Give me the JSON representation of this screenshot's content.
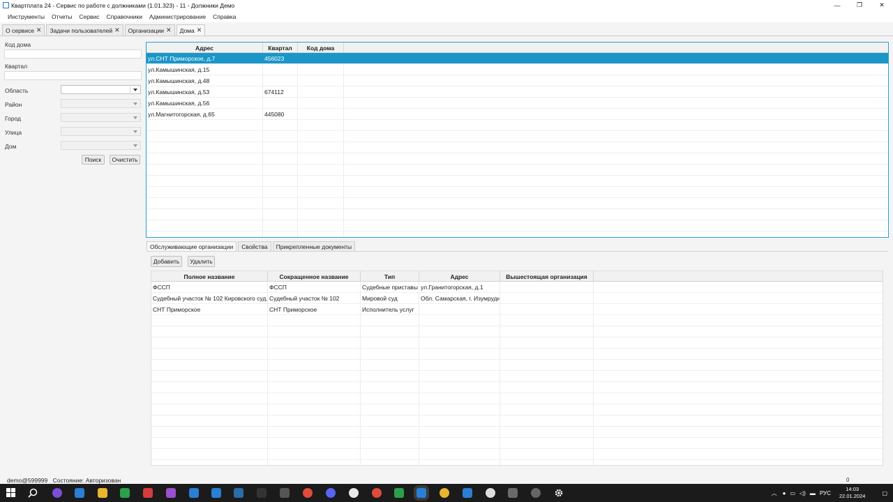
{
  "window": {
    "title": "Квартплата 24 - Сервис по работе с должниками (1.01.323) - 11 - Должники Демо",
    "controls": [
      "—",
      "❐",
      "✕"
    ]
  },
  "menu": [
    "Инструменты",
    "Отчеты",
    "Сервис",
    "Справочники",
    "Администрирование",
    "Справка"
  ],
  "doc_tabs": [
    {
      "label": "О сервисе",
      "close": "✕"
    },
    {
      "label": "Задачи пользователей",
      "close": "✕"
    },
    {
      "label": "Организации",
      "close": "✕"
    },
    {
      "label": "Дома",
      "close": "✕",
      "active": true
    }
  ],
  "filters": {
    "house_code_label": "Код дома",
    "house_code_value": "",
    "quarter_label": "Квартал",
    "quarter_value": "",
    "region_label": "Область",
    "district_label": "Район",
    "city_label": "Город",
    "street_label": "Улица",
    "house_label": "Дом",
    "search_button": "Поиск",
    "clear_button": "Очистить"
  },
  "houses": {
    "columns": [
      "Адрес",
      "Квартал",
      "Код дома"
    ],
    "rows": [
      {
        "address": "ул.СНТ Приморское, д.7",
        "quarter": "456023",
        "code": ""
      },
      {
        "address": "ул.Камышинская, д.15",
        "quarter": "",
        "code": ""
      },
      {
        "address": "ул.Камышинская, д.48",
        "quarter": "",
        "code": ""
      },
      {
        "address": "ул.Камышинская, д.53",
        "quarter": "674112",
        "code": ""
      },
      {
        "address": "ул.Камышинская, д.56",
        "quarter": "",
        "code": ""
      },
      {
        "address": "ул.Магнитогорская, д.65",
        "quarter": "445080",
        "code": ""
      }
    ],
    "selected_index": 0
  },
  "sub_tabs": [
    {
      "label": "Обслуживающие организации",
      "active": true
    },
    {
      "label": "Свойства"
    },
    {
      "label": "Прикрепленные документы"
    }
  ],
  "orgs_toolbar": {
    "add": "Добавить",
    "delete": "Удалить"
  },
  "orgs": {
    "columns": [
      "Полное название",
      "Сокращенное название",
      "Тип",
      "Адрес",
      "Вышестоящая организация"
    ],
    "rows": [
      {
        "full": "ФССП",
        "short": "ФССП",
        "type": "Судебные приставы",
        "address": "ул.Гранитогорская, д.1",
        "parent": ""
      },
      {
        "full": "Судебный участок № 102 Кировского суд...",
        "short": "Судебный участок № 102",
        "type": "Мировой суд",
        "address": "Обл. Самарская, г. Изумрудн...",
        "parent": ""
      },
      {
        "full": "СНТ Приморское",
        "short": "СНТ Приморское",
        "type": "Исполнитель услуг",
        "address": "",
        "parent": ""
      }
    ]
  },
  "status": {
    "user": "demo@599999",
    "state_label": "Состояние:",
    "state_value": "Авторизован",
    "counter": "0"
  },
  "taskbar": {
    "lang": "РУС",
    "time": "14:03",
    "date": "22.01.2024"
  }
}
